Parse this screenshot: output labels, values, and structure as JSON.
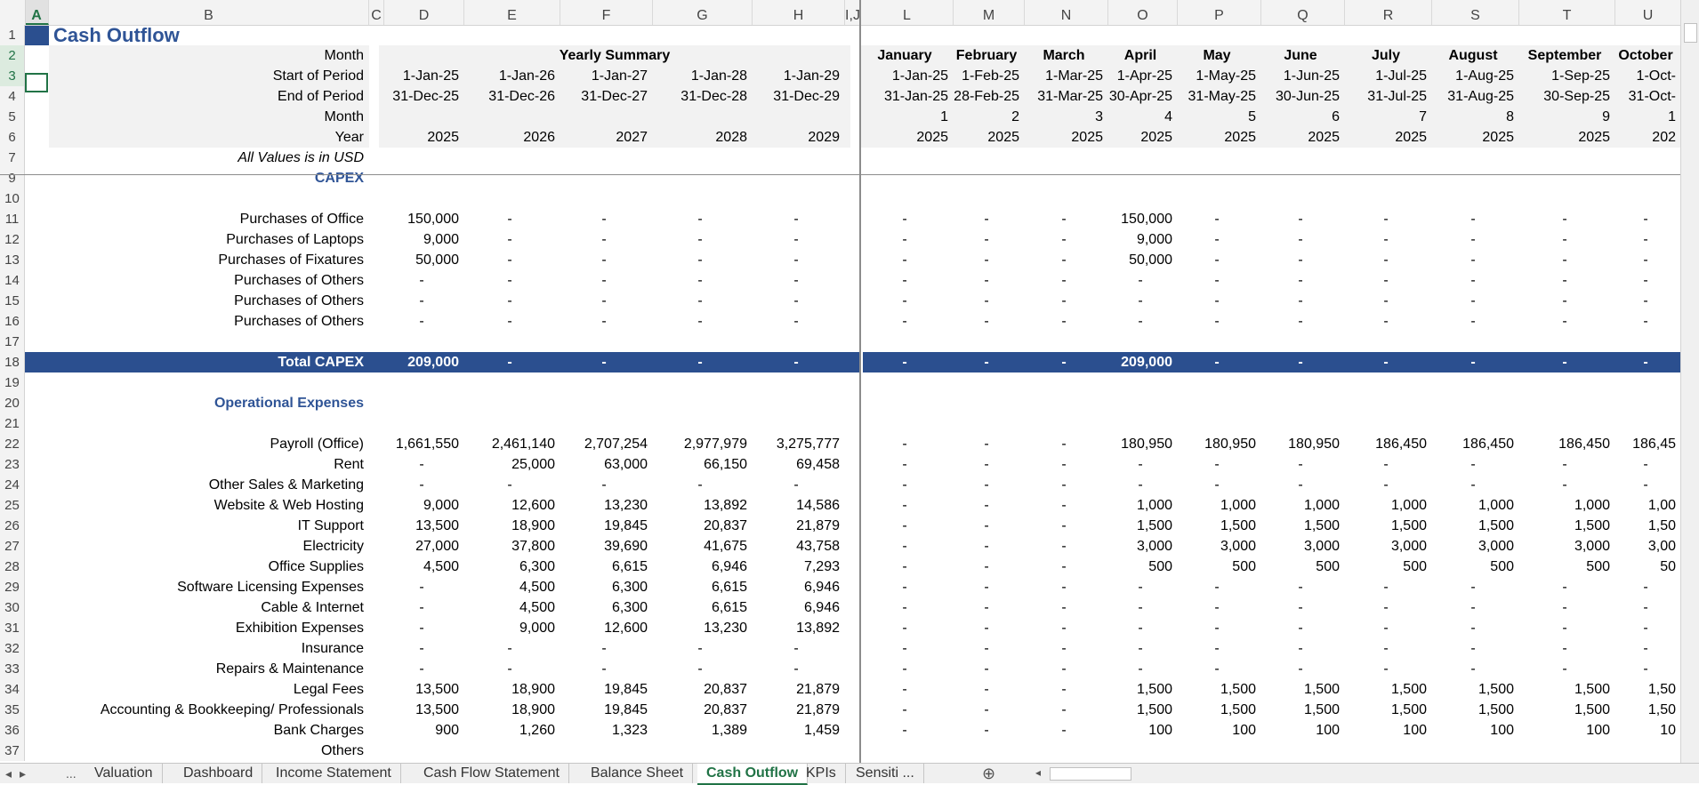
{
  "columns": [
    "A",
    "B",
    "C",
    "D",
    "E",
    "F",
    "G",
    "H",
    "I,J",
    "L",
    "M",
    "N",
    "O",
    "P",
    "Q",
    "R",
    "S",
    "T",
    "U"
  ],
  "title": "Cash Outflow",
  "header_rows": {
    "month_label": "Month",
    "start_label": "Start of Period",
    "end_label": "End of Period",
    "month_num_label": "Month",
    "year_label": "Year",
    "values_note": "All Values is in USD",
    "yearly_summary": "Yearly Summary",
    "yearly_start": [
      "1-Jan-25",
      "1-Jan-26",
      "1-Jan-27",
      "1-Jan-28",
      "1-Jan-29"
    ],
    "yearly_end": [
      "31-Dec-25",
      "31-Dec-26",
      "31-Dec-27",
      "31-Dec-28",
      "31-Dec-29"
    ],
    "yearly_year": [
      "2025",
      "2026",
      "2027",
      "2028",
      "2029"
    ],
    "months": [
      "January",
      "February",
      "March",
      "April",
      "May",
      "June",
      "July",
      "August",
      "September",
      "October"
    ],
    "month_start": [
      "1-Jan-25",
      "1-Feb-25",
      "1-Mar-25",
      "1-Apr-25",
      "1-May-25",
      "1-Jun-25",
      "1-Jul-25",
      "1-Aug-25",
      "1-Sep-25",
      "1-Oct-"
    ],
    "month_end": [
      "31-Jan-25",
      "28-Feb-25",
      "31-Mar-25",
      "30-Apr-25",
      "31-May-25",
      "30-Jun-25",
      "31-Jul-25",
      "31-Aug-25",
      "30-Sep-25",
      "31-Oct-"
    ],
    "month_num": [
      "1",
      "2",
      "3",
      "4",
      "5",
      "6",
      "7",
      "8",
      "9",
      "1"
    ],
    "month_year": [
      "2025",
      "2025",
      "2025",
      "2025",
      "2025",
      "2025",
      "2025",
      "2025",
      "2025",
      "202"
    ]
  },
  "capex_title": "CAPEX",
  "opex_title": "Operational Expenses",
  "rows": [
    {
      "n": "11",
      "label": "Purchases of Office",
      "y": [
        "150,000",
        "-",
        "-",
        "-",
        "-"
      ],
      "m": [
        "-",
        "-",
        "-",
        "150,000",
        "-",
        "-",
        "-",
        "-",
        "-",
        "-"
      ]
    },
    {
      "n": "12",
      "label": "Purchases of Laptops",
      "y": [
        "9,000",
        "-",
        "-",
        "-",
        "-"
      ],
      "m": [
        "-",
        "-",
        "-",
        "9,000",
        "-",
        "-",
        "-",
        "-",
        "-",
        "-"
      ]
    },
    {
      "n": "13",
      "label": "Purchases of Fixatures",
      "y": [
        "50,000",
        "-",
        "-",
        "-",
        "-"
      ],
      "m": [
        "-",
        "-",
        "-",
        "50,000",
        "-",
        "-",
        "-",
        "-",
        "-",
        "-"
      ]
    },
    {
      "n": "14",
      "label": "Purchases of Others",
      "y": [
        "-",
        "-",
        "-",
        "-",
        "-"
      ],
      "m": [
        "-",
        "-",
        "-",
        "-",
        "-",
        "-",
        "-",
        "-",
        "-",
        "-"
      ]
    },
    {
      "n": "15",
      "label": "Purchases of Others",
      "y": [
        "-",
        "-",
        "-",
        "-",
        "-"
      ],
      "m": [
        "-",
        "-",
        "-",
        "-",
        "-",
        "-",
        "-",
        "-",
        "-",
        "-"
      ]
    },
    {
      "n": "16",
      "label": "Purchases of Others",
      "y": [
        "-",
        "-",
        "-",
        "-",
        "-"
      ],
      "m": [
        "-",
        "-",
        "-",
        "-",
        "-",
        "-",
        "-",
        "-",
        "-",
        "-"
      ]
    }
  ],
  "total_capex": {
    "label": "Total CAPEX",
    "y": [
      "209,000",
      "-",
      "-",
      "-",
      "-"
    ],
    "m": [
      "-",
      "-",
      "-",
      "209,000",
      "-",
      "-",
      "-",
      "-",
      "-",
      "-"
    ]
  },
  "opex_rows": [
    {
      "n": "22",
      "label": "Payroll (Office)",
      "y": [
        "1,661,550",
        "2,461,140",
        "2,707,254",
        "2,977,979",
        "3,275,777"
      ],
      "m": [
        "-",
        "-",
        "-",
        "180,950",
        "180,950",
        "180,950",
        "186,450",
        "186,450",
        "186,450",
        "186,45"
      ]
    },
    {
      "n": "23",
      "label": "Rent",
      "y": [
        "-",
        "25,000",
        "63,000",
        "66,150",
        "69,458"
      ],
      "m": [
        "-",
        "-",
        "-",
        "-",
        "-",
        "-",
        "-",
        "-",
        "-",
        "-"
      ]
    },
    {
      "n": "24",
      "label": "Other Sales & Marketing",
      "y": [
        "-",
        "-",
        "-",
        "-",
        "-"
      ],
      "m": [
        "-",
        "-",
        "-",
        "-",
        "-",
        "-",
        "-",
        "-",
        "-",
        "-"
      ]
    },
    {
      "n": "25",
      "label": "Website & Web Hosting",
      "y": [
        "9,000",
        "12,600",
        "13,230",
        "13,892",
        "14,586"
      ],
      "m": [
        "-",
        "-",
        "-",
        "1,000",
        "1,000",
        "1,000",
        "1,000",
        "1,000",
        "1,000",
        "1,00"
      ]
    },
    {
      "n": "26",
      "label": "IT Support",
      "y": [
        "13,500",
        "18,900",
        "19,845",
        "20,837",
        "21,879"
      ],
      "m": [
        "-",
        "-",
        "-",
        "1,500",
        "1,500",
        "1,500",
        "1,500",
        "1,500",
        "1,500",
        "1,50"
      ]
    },
    {
      "n": "27",
      "label": "Electricity",
      "y": [
        "27,000",
        "37,800",
        "39,690",
        "41,675",
        "43,758"
      ],
      "m": [
        "-",
        "-",
        "-",
        "3,000",
        "3,000",
        "3,000",
        "3,000",
        "3,000",
        "3,000",
        "3,00"
      ]
    },
    {
      "n": "28",
      "label": "Office Supplies",
      "y": [
        "4,500",
        "6,300",
        "6,615",
        "6,946",
        "7,293"
      ],
      "m": [
        "-",
        "-",
        "-",
        "500",
        "500",
        "500",
        "500",
        "500",
        "500",
        "50"
      ]
    },
    {
      "n": "29",
      "label": "Software Licensing Expenses",
      "y": [
        "-",
        "4,500",
        "6,300",
        "6,615",
        "6,946"
      ],
      "m": [
        "-",
        "-",
        "-",
        "-",
        "-",
        "-",
        "-",
        "-",
        "-",
        "-"
      ]
    },
    {
      "n": "30",
      "label": "Cable & Internet",
      "y": [
        "-",
        "4,500",
        "6,300",
        "6,615",
        "6,946"
      ],
      "m": [
        "-",
        "-",
        "-",
        "-",
        "-",
        "-",
        "-",
        "-",
        "-",
        "-"
      ]
    },
    {
      "n": "31",
      "label": "Exhibition Expenses",
      "y": [
        "-",
        "9,000",
        "12,600",
        "13,230",
        "13,892"
      ],
      "m": [
        "-",
        "-",
        "-",
        "-",
        "-",
        "-",
        "-",
        "-",
        "-",
        "-"
      ]
    },
    {
      "n": "32",
      "label": "Insurance",
      "y": [
        "-",
        "-",
        "-",
        "-",
        "-"
      ],
      "m": [
        "-",
        "-",
        "-",
        "-",
        "-",
        "-",
        "-",
        "-",
        "-",
        "-"
      ]
    },
    {
      "n": "33",
      "label": "Repairs & Maintenance",
      "y": [
        "-",
        "-",
        "-",
        "-",
        "-"
      ],
      "m": [
        "-",
        "-",
        "-",
        "-",
        "-",
        "-",
        "-",
        "-",
        "-",
        "-"
      ]
    },
    {
      "n": "34",
      "label": "Legal Fees",
      "y": [
        "13,500",
        "18,900",
        "19,845",
        "20,837",
        "21,879"
      ],
      "m": [
        "-",
        "-",
        "-",
        "1,500",
        "1,500",
        "1,500",
        "1,500",
        "1,500",
        "1,500",
        "1,50"
      ]
    },
    {
      "n": "35",
      "label": "Accounting & Bookkeeping/ Professionals",
      "y": [
        "13,500",
        "18,900",
        "19,845",
        "20,837",
        "21,879"
      ],
      "m": [
        "-",
        "-",
        "-",
        "1,500",
        "1,500",
        "1,500",
        "1,500",
        "1,500",
        "1,500",
        "1,50"
      ]
    },
    {
      "n": "36",
      "label": "Bank Charges",
      "y": [
        "900",
        "1,260",
        "1,323",
        "1,389",
        "1,459"
      ],
      "m": [
        "-",
        "-",
        "-",
        "100",
        "100",
        "100",
        "100",
        "100",
        "100",
        "10"
      ]
    },
    {
      "n": "37",
      "label": "Others",
      "y": [
        "",
        "",
        "",
        "",
        ""
      ],
      "m": [
        "",
        "",
        "",
        "",
        "",
        "",
        "",
        "",
        "",
        ""
      ]
    }
  ],
  "tabs": [
    "Valuation",
    "Dashboard",
    "Income Statement",
    "Cash Flow Statement",
    "Balance Sheet",
    "Cash Outflow",
    "KPIs",
    "Sensiti ..."
  ],
  "active_tab": "Cash Outflow",
  "nav": {
    "prev": "◂",
    "next": "▸",
    "more": "...",
    "add": "⊕"
  },
  "colors": {
    "accent": "#2b4f8f",
    "excel_green": "#217346",
    "section": "#2f5496"
  }
}
